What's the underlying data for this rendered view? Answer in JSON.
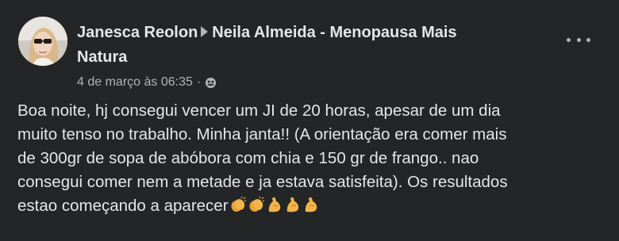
{
  "post": {
    "author": "Janesca Reolon",
    "group": "Neila Almeida - Menopausa Mais Natura",
    "title_line1_group": "Neila Almeida - Menopausa Mais",
    "title_line2_group": "Natura",
    "timestamp": "4 de março às 06:35",
    "separator": "·",
    "privacy_icon": "globe-icon",
    "more_icon": "more-options-icon",
    "body_lines": [
      "Boa noite, hj consegui vencer um JI de 20 horas, apesar de um dia",
      "muito tenso no trabalho. Minha janta!! (A orientação era comer mais",
      "de 300gr de sopa de abóbora com chia e 150 gr de frango.. nao",
      "consegui comer nem a metade e ja estava satisfeita). Os resultados",
      "estao começando a aparecer"
    ],
    "emojis": [
      "clapping-hands-icon",
      "clapping-hands-icon",
      "flexed-biceps-icon",
      "flexed-biceps-icon",
      "flexed-biceps-icon"
    ]
  },
  "colors": {
    "background": "#242526",
    "primary_text": "#e4e6eb",
    "secondary_text": "#b0b3b8",
    "emoji": "#e8a23a"
  }
}
